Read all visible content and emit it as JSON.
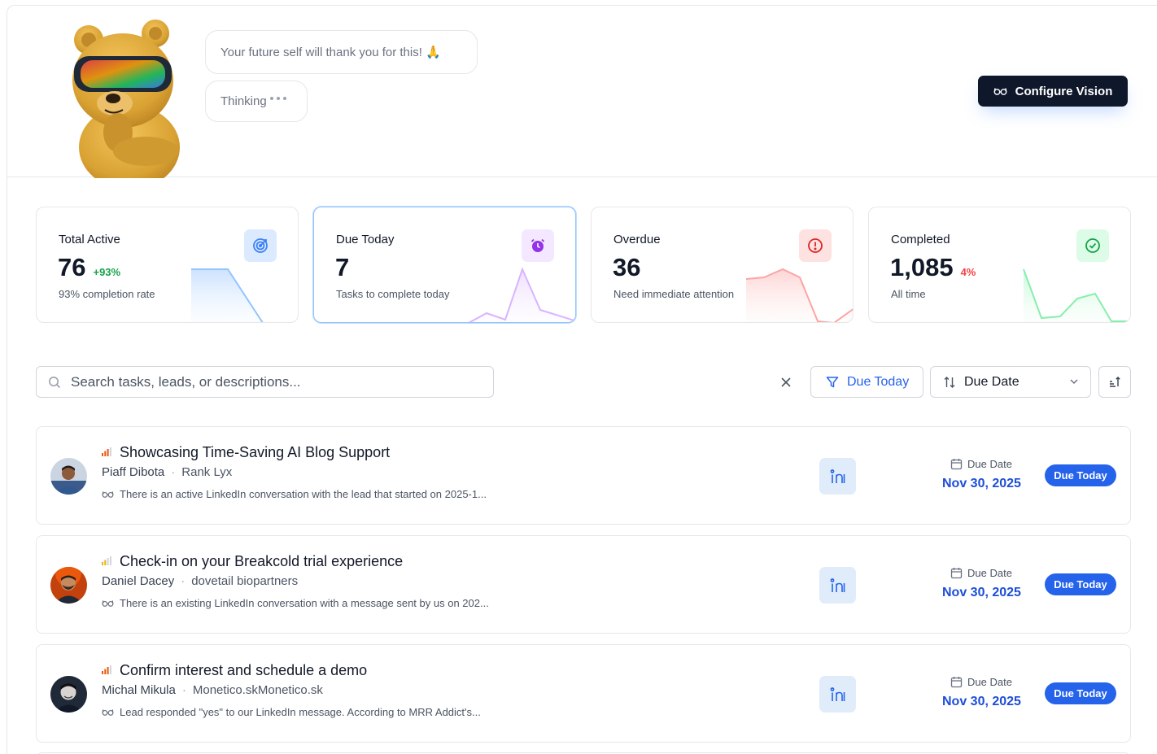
{
  "header": {
    "bubble_message": "Your future self will thank you for this! 🙏",
    "bubble_thinking": "Thinking",
    "configure_label": "Configure Vision"
  },
  "stats": [
    {
      "label": "Total Active",
      "value": "76",
      "delta": "+93%",
      "delta_color": "#16a34a",
      "sub": "93% completion rate",
      "icon": "target-icon",
      "accent": "#3b82f6"
    },
    {
      "label": "Due Today",
      "value": "7",
      "delta": "",
      "delta_color": "#16a34a",
      "sub": "Tasks to complete today",
      "icon": "alarm-clock-icon",
      "accent": "#9333ea"
    },
    {
      "label": "Overdue",
      "value": "36",
      "delta": "",
      "delta_color": "#dc2626",
      "sub": "Need immediate attention",
      "icon": "alert-circle-icon",
      "accent": "#dc2626"
    },
    {
      "label": "Completed",
      "value": "1,085",
      "delta": "4%",
      "delta_color": "#ef4444",
      "sub": "All time",
      "icon": "check-circle-icon",
      "accent": "#16a34a"
    }
  ],
  "toolbar": {
    "search_placeholder": "Search tasks, leads, or descriptions...",
    "filter_label": "Due Today",
    "sort_label": "Due Date"
  },
  "tasks": [
    {
      "title": "Showcasing Time-Saving AI Blog Support",
      "person": "Piaff Dibota",
      "company": "Rank Lyx",
      "description": "There is an active LinkedIn conversation with the lead that started on 2025-1...",
      "channel_icon": "linkedin-icon",
      "due_label": "Due Date",
      "due_date": "Nov 30, 2025",
      "status": "Due Today",
      "priority_color": "#ea580c"
    },
    {
      "title": "Check-in on your Breakcold trial experience",
      "person": "Daniel Dacey",
      "company": "dovetail biopartners",
      "description": "There is an existing LinkedIn conversation with a message sent by us on 202...",
      "channel_icon": "linkedin-icon",
      "due_label": "Due Date",
      "due_date": "Nov 30, 2025",
      "status": "Due Today",
      "priority_color": "#eab308"
    },
    {
      "title": "Confirm interest and schedule a demo",
      "person": "Michal Mikula",
      "company": "Monetico.skMonetico.sk",
      "description": "Lead responded \"yes\" to our LinkedIn message. According to MRR Addict's...",
      "channel_icon": "linkedin-icon",
      "due_label": "Due Date",
      "due_date": "Nov 30, 2025",
      "status": "Due Today",
      "priority_color": "#ea580c"
    }
  ]
}
